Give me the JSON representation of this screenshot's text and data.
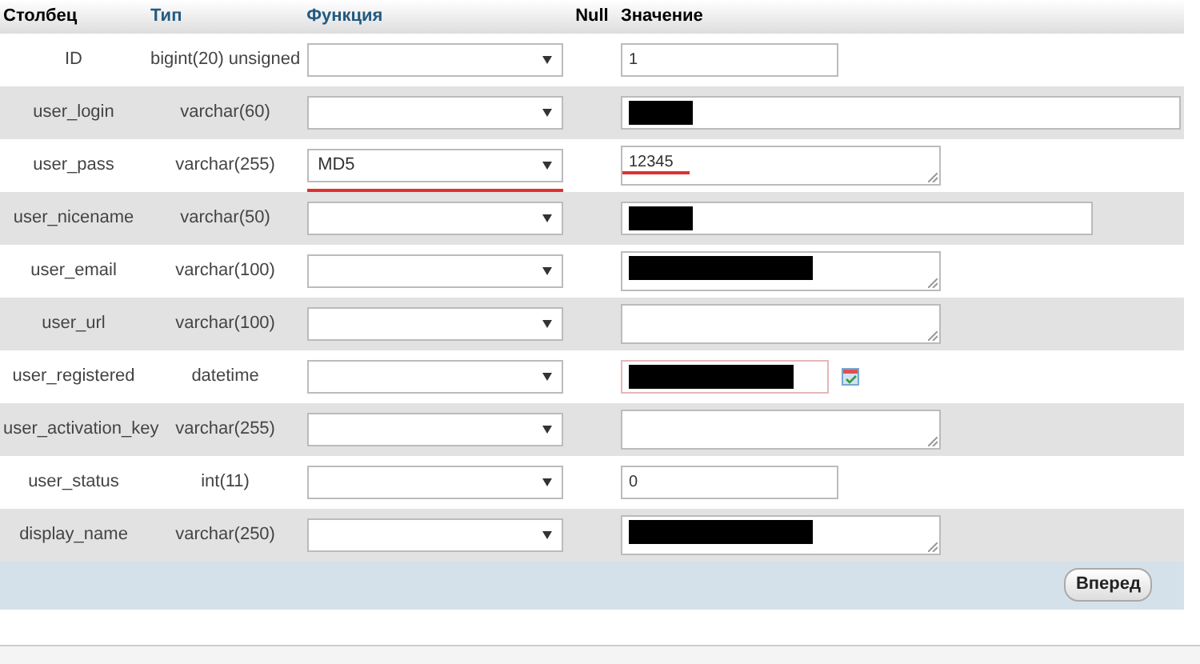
{
  "table": {
    "columns": [
      {
        "label": "Столбец",
        "link": false
      },
      {
        "label": "Тип",
        "link": true
      },
      {
        "label": "Функция",
        "link": true
      },
      {
        "label": "Null",
        "link": false
      },
      {
        "label": "Значение",
        "link": false
      }
    ],
    "rows": [
      {
        "column": "ID",
        "type": "bigint(20) unsigned",
        "function": "",
        "function_marked": false,
        "kind": "input",
        "value": "1",
        "value_marked": false,
        "redacted": false
      },
      {
        "column": "user_login",
        "type": "varchar(60)",
        "function": "",
        "function_marked": false,
        "kind": "wide",
        "value": "",
        "value_marked": false,
        "redacted": true
      },
      {
        "column": "user_pass",
        "type": "varchar(255)",
        "function": "MD5",
        "function_marked": true,
        "kind": "textarea",
        "value": "12345",
        "value_marked": true,
        "redacted": false
      },
      {
        "column": "user_nicename",
        "type": "varchar(50)",
        "function": "",
        "function_marked": false,
        "kind": "medium",
        "value": "",
        "value_marked": false,
        "redacted": true
      },
      {
        "column": "user_email",
        "type": "varchar(100)",
        "function": "",
        "function_marked": false,
        "kind": "textarea",
        "value": "",
        "value_marked": false,
        "redacted": true
      },
      {
        "column": "user_url",
        "type": "varchar(100)",
        "function": "",
        "function_marked": false,
        "kind": "textarea",
        "value": "",
        "value_marked": false,
        "redacted": false
      },
      {
        "column": "user_registered",
        "type": "datetime",
        "function": "",
        "function_marked": false,
        "kind": "date",
        "value": "",
        "value_marked": false,
        "redacted": true
      },
      {
        "column": "user_activation_key",
        "type": "varchar(255)",
        "function": "",
        "function_marked": false,
        "kind": "textarea",
        "value": "",
        "value_marked": false,
        "redacted": false
      },
      {
        "column": "user_status",
        "type": "int(11)",
        "function": "",
        "function_marked": false,
        "kind": "input",
        "value": "0",
        "value_marked": false,
        "redacted": false
      },
      {
        "column": "display_name",
        "type": "varchar(250)",
        "function": "",
        "function_marked": false,
        "kind": "textarea",
        "value": "",
        "value_marked": false,
        "redacted": true
      }
    ]
  },
  "submit_button": "Вперед"
}
